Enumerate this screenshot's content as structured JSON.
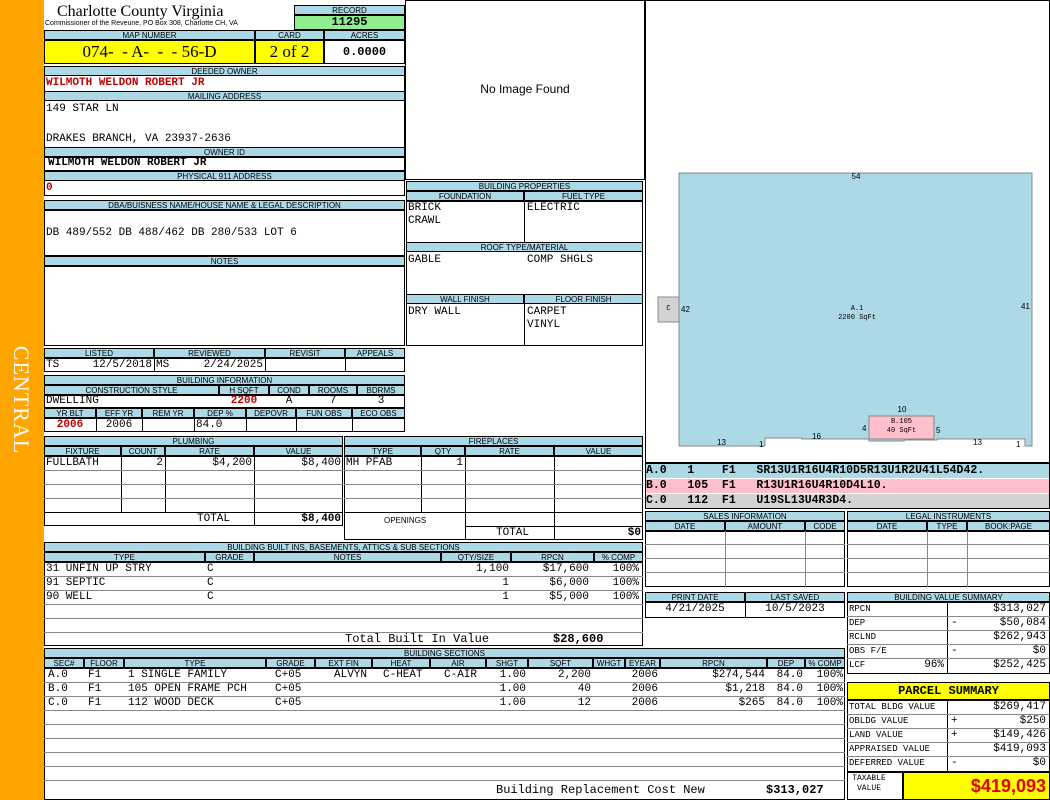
{
  "sidebar": {
    "district": "CENTRAL"
  },
  "header": {
    "county": "Charlotte County Virginia",
    "commissioner": "Commissioner of the Reveune, PO Box 308, Charlotte CH, VA",
    "record_label": "RECORD",
    "record": "11295",
    "map_label": "MAP NUMBER",
    "map": "074-  - A-  -  - 56-D",
    "card_label": "CARD",
    "card": "2 of 2",
    "acres_label": "ACRES",
    "acres": "0.0000"
  },
  "owner": {
    "deeded_label": "DEEDED OWNER",
    "deeded": "WILMOTH WELDON ROBERT JR",
    "mailing_label": "MAILING ADDRESS",
    "mail1": "149 STAR LN",
    "mail2": "DRAKES BRANCH, VA 23937-2636",
    "ownerid_label": "OWNER ID",
    "ownerid": "WILMOTH WELDON ROBERT JR",
    "phys_label": "PHYSICAL 911 ADDRESS",
    "phys": "0"
  },
  "legal": {
    "label": "DBA/BUISNESS NAME/HOUSE NAME & LEGAL DESCRIPTION",
    "text": "DB 489/552 DB 488/462 DB 280/533 LOT 6",
    "notes_label": "NOTES"
  },
  "image": {
    "text": "No Image Found"
  },
  "review": {
    "listed_label": "LISTED",
    "listed_by": "TS",
    "listed_date": "12/5/2018",
    "reviewed_label": "REVIEWED",
    "reviewed_by": "MS",
    "reviewed_date": "2/24/2025",
    "revisit_label": "REVISIT",
    "appeals_label": "APPEALS"
  },
  "bldg_info": {
    "label": "BUILDING INFORMATION",
    "h": [
      "CONSTRUCTION STYLE",
      "H SQFT",
      "COND",
      "ROOMS",
      "BDRMS"
    ],
    "style": "DWELLING",
    "hsqft": "2200",
    "cond": "A",
    "rooms": "7",
    "bdrms": "3",
    "h2": [
      "YR BLT",
      "EFF YR",
      "REM YR",
      "DEP %",
      "DEPOVR",
      "FUN OBS",
      "ECO OBS"
    ],
    "yrblt": "2006",
    "effyr": "2006",
    "dep": "84.0"
  },
  "bprops": {
    "label": "BUILDING PROPERTIES",
    "foundation_label": "FOUNDATION",
    "foundation1": "BRICK",
    "foundation2": "CRAWL",
    "fuel_label": "FUEL TYPE",
    "fuel": "ELECTRIC",
    "roof_label": "ROOF TYPE/MATERIAL",
    "roof1": "GABLE",
    "roof2": "COMP SHGLS",
    "wall_label": "WALL FINISH",
    "wall": "DRY WALL",
    "floor_label": "FLOOR FINISH",
    "floor1": "CARPET",
    "floor2": "VINYL"
  },
  "sketch": {
    "top": "54",
    "left": "42",
    "right": "41",
    "b_top": "10",
    "b_left": "4",
    "b_right": "5",
    "bot1": "13",
    "bot2": "1",
    "bot3": "16",
    "bot4": "13",
    "bot5": "1",
    "main_name": "A.1",
    "main_area": "2200 SqFt",
    "b_name": "B.105",
    "b_area": "40 SqFt",
    "c_name": "C",
    "legend": [
      {
        "text": "A.0   1    F1   SR13U1R16U4R10D5R13U1R2U41L54D42.",
        "bg": "#add8e6"
      },
      {
        "text": "B.0   105  F1   R13U1R16U4R10D4L10.",
        "bg": "#ffc0cb"
      },
      {
        "text": "C.0   112  F1   U19SL13U4R3D4.",
        "bg": "#d3d3d3"
      }
    ]
  },
  "plumbing": {
    "label": "PLUMBING",
    "h": [
      "FIXTURE",
      "COUNT",
      "RATE",
      "VALUE"
    ],
    "rows": [
      {
        "fixture": "FULLBATH",
        "count": "2",
        "rate": "$4,200",
        "value": "$8,400"
      }
    ],
    "total_label": "TOTAL",
    "total": "$8,400"
  },
  "fireplaces": {
    "label": "FIREPLACES",
    "h": [
      "TYPE",
      "QTY",
      "RATE",
      "VALUE"
    ],
    "rows": [
      {
        "type": "MH PFAB",
        "qty": "1"
      }
    ],
    "openings_label": "OPENINGS",
    "total_label": "TOTAL",
    "total": "$0"
  },
  "sales": {
    "label": "SALES INFORMATION",
    "h": [
      "DATE",
      "AMOUNT",
      "CODE"
    ]
  },
  "legal_instr": {
    "label": "LEGAL INSTRUMENTS",
    "h": [
      "DATE",
      "TYPE",
      "BOOK:PAGE"
    ]
  },
  "builtins": {
    "label": "BUILDING BUILT INS, BASEMENTS, ATTICS & SUB SECTIONS",
    "h": [
      "TYPE",
      "GRADE",
      "NOTES",
      "QTY/SIZE",
      "RPCN",
      "% COMP"
    ],
    "rows": [
      {
        "type": "31 UNFIN UP STRY",
        "grade": "C",
        "qty": "1,100",
        "rpcn": "$17,600",
        "comp": "100%"
      },
      {
        "type": "91 SEPTIC",
        "grade": "C",
        "qty": "1",
        "rpcn": "$6,000",
        "comp": "100%"
      },
      {
        "type": "90 WELL",
        "grade": "C",
        "qty": "1",
        "rpcn": "$5,000",
        "comp": "100%"
      }
    ],
    "total_label": "Total Built In Value",
    "total": "$28,600"
  },
  "dates": {
    "print_label": "PRINT DATE",
    "print": "4/21/2025",
    "saved_label": "LAST SAVED",
    "saved": "10/5/2023"
  },
  "bvs": {
    "label": "BUILDING VALUE SUMMARY",
    "rows": [
      {
        "k": "RPCN",
        "s": "",
        "v": "$313,027"
      },
      {
        "k": "DEP",
        "s": "-",
        "v": "$50,084"
      },
      {
        "k": "RCLND",
        "s": "",
        "v": "$262,943"
      },
      {
        "k": "OBS F/E",
        "s": "-",
        "v": "$0"
      },
      {
        "k": "LCF",
        "s": "96%",
        "v": "$252,425"
      }
    ]
  },
  "parcel": {
    "label": "PARCEL SUMMARY",
    "rows": [
      {
        "k": "TOTAL BLDG VALUE",
        "s": "",
        "v": "$269,417"
      },
      {
        "k": "OBLDG VALUE",
        "s": "+",
        "v": "$250"
      },
      {
        "k": "LAND VALUE",
        "s": "+",
        "v": "$149,426"
      },
      {
        "k": "APPRAISED VALUE",
        "s": "",
        "v": "$419,093"
      },
      {
        "k": "DEFERRED VALUE",
        "s": "-",
        "v": "$0"
      }
    ],
    "taxable_label": "TAXABLE VALUE",
    "taxable": "$419,093"
  },
  "sections": {
    "label": "BUILDING SECTIONS",
    "h": [
      "SEC#",
      "FLOOR",
      "TYPE",
      "GRADE",
      "EXT FIN",
      "HEAT",
      "AIR",
      "SHGT",
      "SQFT",
      "WHGT",
      "EYEAR",
      "RPCN",
      "DEP",
      "% COMP"
    ],
    "rows": [
      {
        "sec": "A.0",
        "floor": "F1",
        "type": "1 SINGLE FAMILY",
        "grade": "C+05",
        "ext": "ALVYN",
        "heat": "C-HEAT",
        "air": "C-AIR",
        "shgt": "1.00",
        "sqft": "2,200",
        "eyear": "2006",
        "rpcn": "$274,544",
        "dep": "84.0",
        "comp": "100%"
      },
      {
        "sec": "B.0",
        "floor": "F1",
        "type": "105 OPEN FRAME PCH",
        "grade": "C+05",
        "ext": "",
        "heat": "",
        "air": "",
        "shgt": "1.00",
        "sqft": "40",
        "eyear": "2006",
        "rpcn": "$1,218",
        "dep": "84.0",
        "comp": "100%"
      },
      {
        "sec": "C.0",
        "floor": "F1",
        "type": "112 WOOD DECK",
        "grade": "C+05",
        "ext": "",
        "heat": "",
        "air": "",
        "shgt": "1.00",
        "sqft": "12",
        "eyear": "2006",
        "rpcn": "$265",
        "dep": "84.0",
        "comp": "100%"
      }
    ],
    "total_label": "Building Replacement Cost New",
    "total": "$313,027"
  }
}
